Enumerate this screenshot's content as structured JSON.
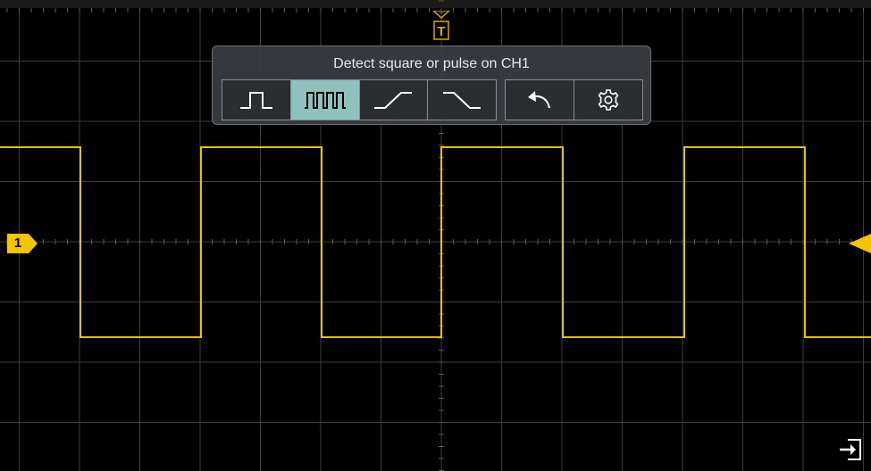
{
  "popup": {
    "title": "Detect square or pulse on CH1",
    "buttons": [
      {
        "icon": "single-pulse-icon",
        "active": false
      },
      {
        "icon": "pulse-train-icon",
        "active": true
      },
      {
        "icon": "rising-edge-icon",
        "active": false
      },
      {
        "icon": "falling-edge-icon",
        "active": false
      }
    ],
    "actions": [
      {
        "icon": "undo-icon"
      },
      {
        "icon": "gear-icon"
      }
    ]
  },
  "trigger": {
    "label": "T",
    "icon": "trigger-position-icon"
  },
  "channel": {
    "label": "1",
    "color": "#f2c500"
  },
  "trace_color": "#e6c200",
  "exit_icon": "exit-icon",
  "colors": {
    "background": "#000000",
    "grid": "#3c3c3c",
    "active_button": "#8fc2bf"
  }
}
